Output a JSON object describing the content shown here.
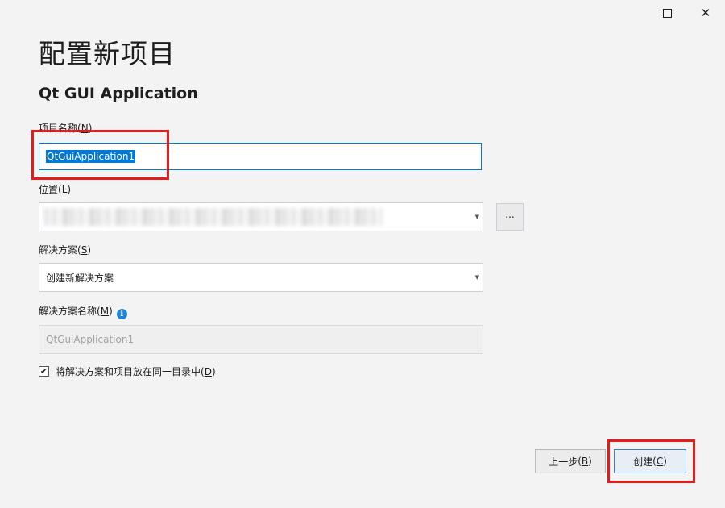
{
  "window": {
    "maximize_icon": "maximize-icon",
    "close_glyph": "✕"
  },
  "header": {
    "title": "配置新项目",
    "subtitle": "Qt GUI Application"
  },
  "project_name": {
    "label": "项目名称",
    "mnemonic": "N",
    "value": "QtGuiApplication1"
  },
  "location": {
    "label": "位置",
    "mnemonic": "L",
    "browse_label": "..."
  },
  "solution": {
    "label": "解决方案",
    "mnemonic": "S",
    "selected": "创建新解决方案"
  },
  "solution_name": {
    "label": "解决方案名称",
    "mnemonic": "M",
    "value": "QtGuiApplication1",
    "info_glyph": "i"
  },
  "same_dir": {
    "label": "将解决方案和项目放在同一目录中",
    "mnemonic": "D",
    "checked": true,
    "check_glyph": "✔"
  },
  "footer": {
    "back_label": "上一步",
    "back_mnemonic": "B",
    "create_label": "创建",
    "create_mnemonic": "C"
  },
  "colors": {
    "selection": "#0078d7",
    "highlight_box": "#e31b1b",
    "info": "#1c87d6"
  }
}
